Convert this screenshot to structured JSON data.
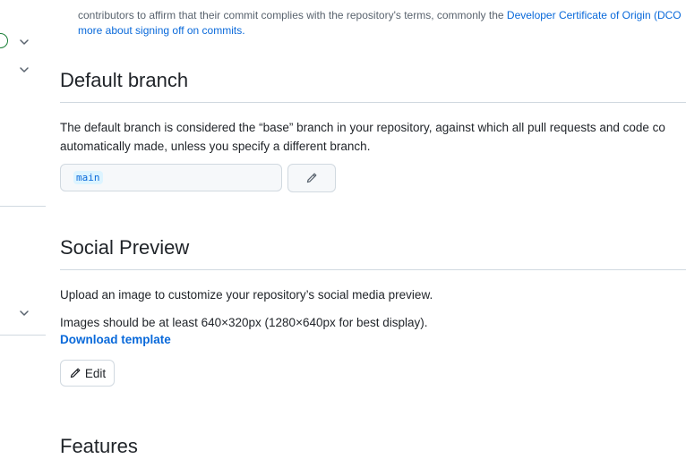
{
  "top_text": {
    "line1_prefix": "contributors to affirm that their commit complies with the repository's terms, commonly the ",
    "line1_link": "Developer Certificate of Origin (DCO",
    "line2_link": "more about signing off on commits."
  },
  "default_branch": {
    "title": "Default branch",
    "description_line1": "The default branch is considered the “base” branch in your repository, against which all pull requests and code co",
    "description_line2": "automatically made, unless you specify a different branch.",
    "branch_name": "main"
  },
  "social_preview": {
    "title": "Social Preview",
    "description": "Upload an image to customize your repository’s social media preview.",
    "size_hint": "Images should be at least 640×320px (1280×640px for best display).",
    "download_link": "Download template",
    "edit_label": "Edit"
  },
  "features": {
    "title": "Features"
  },
  "colors": {
    "accent": "#0969da",
    "border": "#d1d9e0",
    "success": "#1a7f37"
  }
}
